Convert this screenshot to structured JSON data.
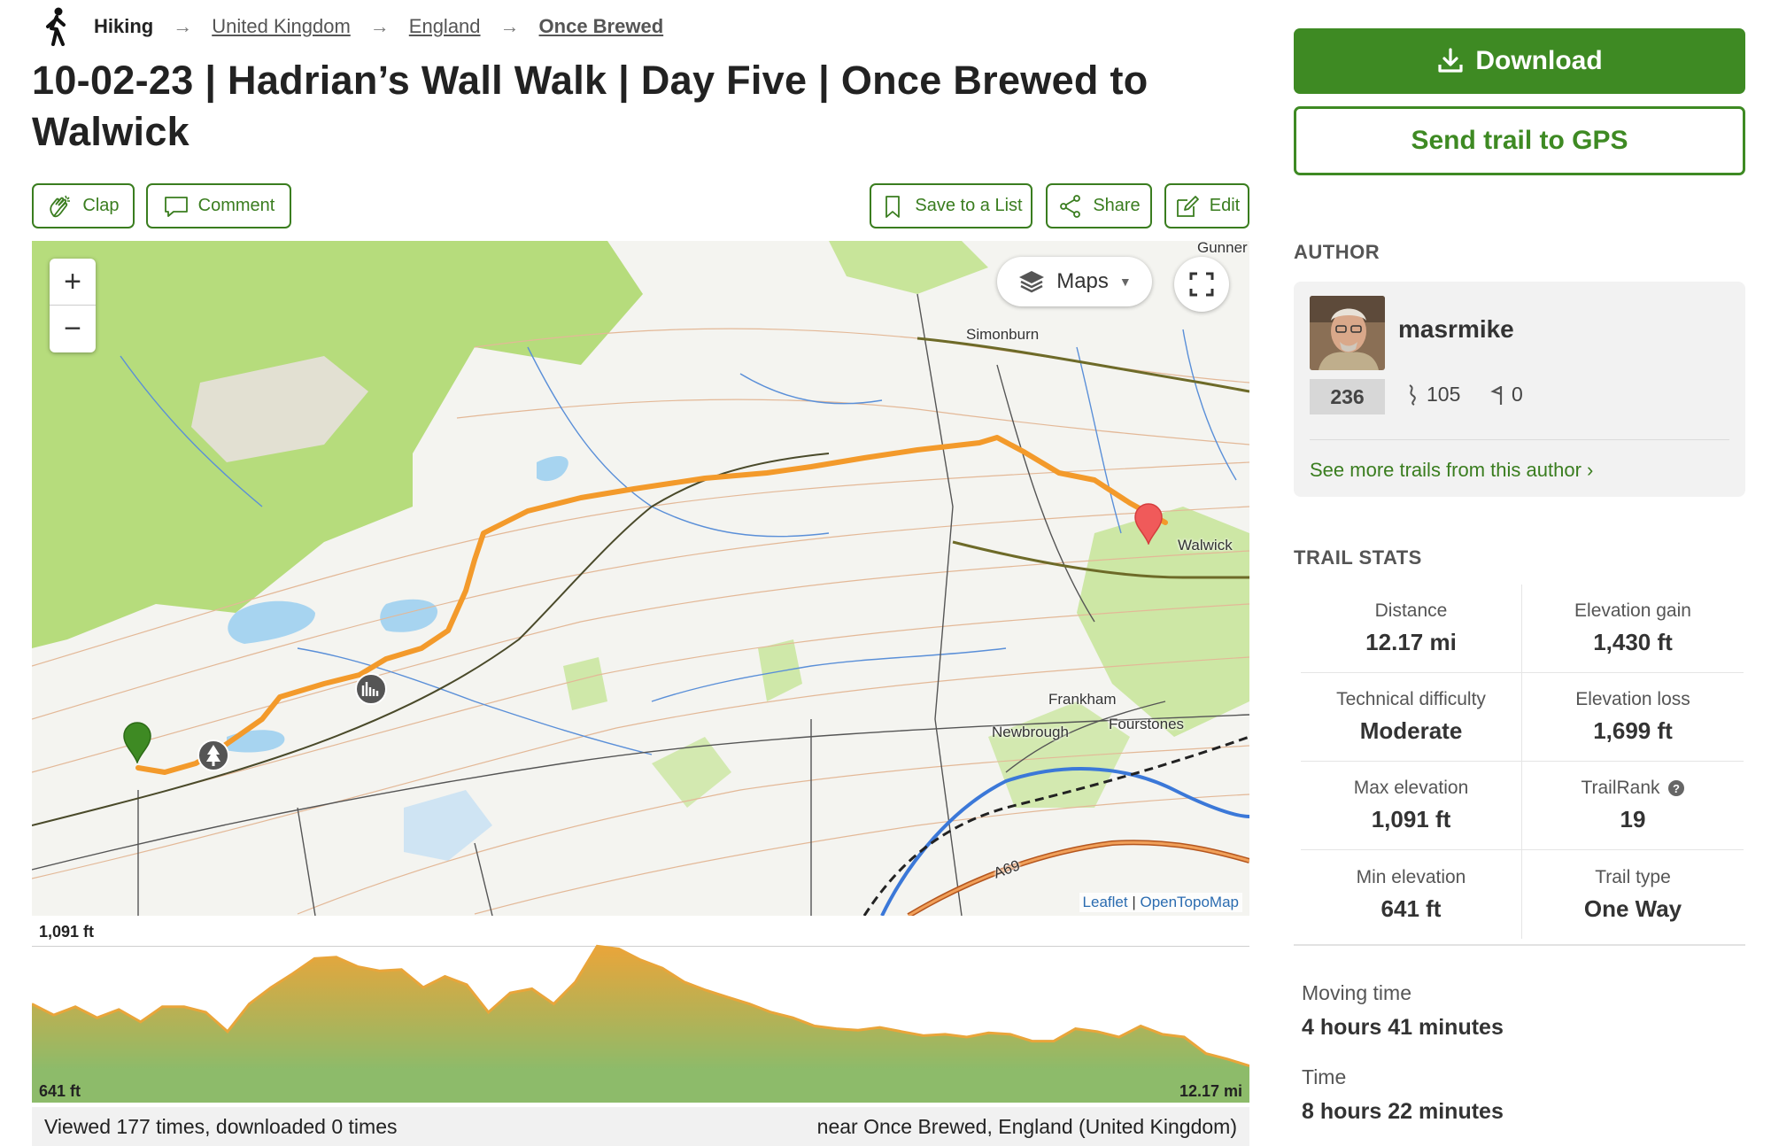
{
  "breadcrumb": {
    "activity": "Hiking",
    "items": [
      "United Kingdom",
      "England",
      "Once Brewed"
    ]
  },
  "title": "10-02-23 | Hadrian’s Wall Walk | Day Five | Once Brewed to Walwick",
  "actions": {
    "clap": "Clap",
    "comment": "Comment",
    "save": "Save to a List",
    "share": "Share",
    "edit": "Edit"
  },
  "map": {
    "zoom_in": "+",
    "zoom_out": "−",
    "layers_label": "Maps",
    "places": {
      "simonburn": "Simonburn",
      "walwick": "Walwick",
      "frankham": "Frankham",
      "newbrough": "Newbrough",
      "fourstones": "Fourstones",
      "a69": "A69",
      "gunner": "Gunner"
    },
    "attribution_leaflet": "Leaflet",
    "attribution_sep": " | ",
    "attribution_topo": "OpenTopoMap"
  },
  "elevation": {
    "max": "1,091 ft",
    "min": "641 ft",
    "distance": "12.17 mi",
    "profile_ft": [
      880,
      840,
      870,
      830,
      860,
      815,
      870,
      870,
      850,
      780,
      880,
      940,
      990,
      1045,
      1050,
      1015,
      1000,
      1005,
      940,
      980,
      950,
      850,
      920,
      935,
      880,
      960,
      1090,
      1080,
      1040,
      1010,
      960,
      930,
      905,
      880,
      850,
      830,
      800,
      790,
      785,
      795,
      780,
      765,
      770,
      760,
      775,
      770,
      745,
      745,
      790,
      780,
      760,
      800,
      770,
      760,
      700,
      680,
      655
    ]
  },
  "stats_bar": {
    "views": "Viewed 177 times, downloaded 0 times",
    "location": "near Once Brewed, England (United Kingdom)"
  },
  "sidebar": {
    "download": "Download",
    "send_gps": "Send trail to GPS",
    "author_heading": "AUTHOR",
    "author": {
      "name": "masrmike",
      "rank": "236",
      "trails": "105",
      "followers": "0",
      "more_link": "See more trails from this author ›"
    },
    "trail_stats_heading": "TRAIL STATS",
    "stats": [
      [
        {
          "label": "Distance",
          "value": "12.17 mi"
        },
        {
          "label": "Elevation gain",
          "value": "1,430 ft"
        }
      ],
      [
        {
          "label": "Technical difficulty",
          "value": "Moderate"
        },
        {
          "label": "Elevation loss",
          "value": "1,699 ft"
        }
      ],
      [
        {
          "label": "Max elevation",
          "value": "1,091 ft"
        },
        {
          "label": "TrailRank",
          "value": "19"
        }
      ],
      [
        {
          "label": "Min elevation",
          "value": "641 ft"
        },
        {
          "label": "Trail type",
          "value": "One Way"
        }
      ]
    ],
    "moving_time_label": "Moving time",
    "moving_time": "4 hours 41 minutes",
    "time_label": "Time",
    "time": "8 hours 22 minutes"
  },
  "colors": {
    "brand_green": "#3e8a23",
    "route_orange": "#f39a2b",
    "elevation_top": "#e9a53a",
    "elevation_bottom": "#8dbb6a"
  }
}
